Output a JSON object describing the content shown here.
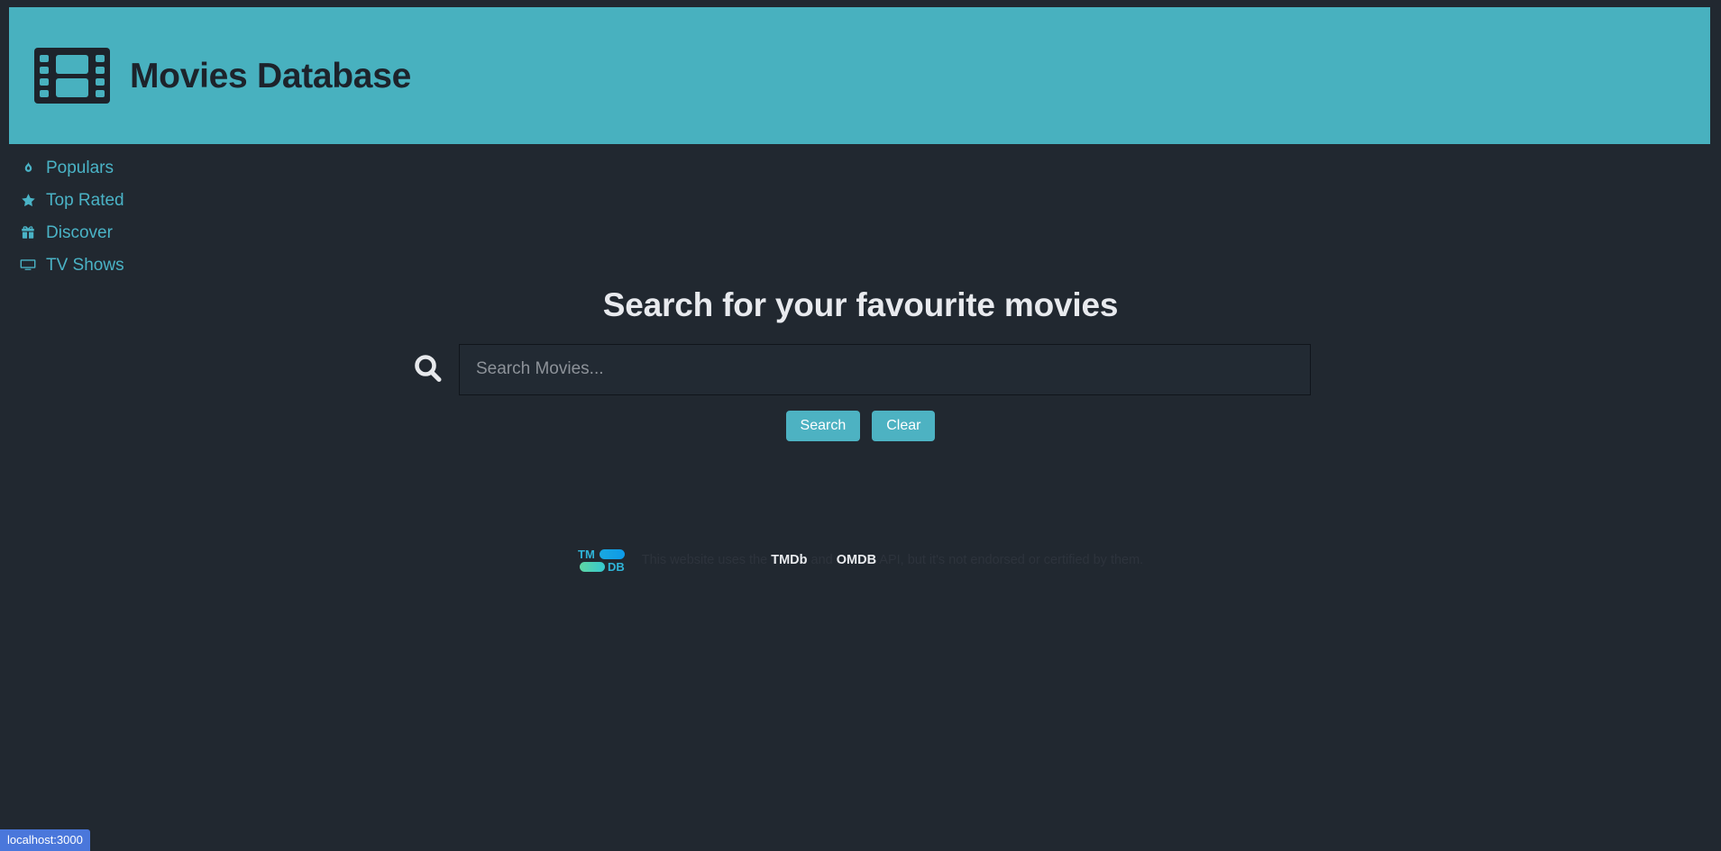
{
  "header": {
    "title": "Movies Database",
    "logo_icon": "film-strip-icon",
    "background_color": "#48b1bf",
    "title_color": "#1d232b"
  },
  "nav": {
    "items": [
      {
        "label": "Populars",
        "icon": "fire-icon"
      },
      {
        "label": "Top Rated",
        "icon": "star-icon"
      },
      {
        "label": "Discover",
        "icon": "gift-icon"
      },
      {
        "label": "TV Shows",
        "icon": "tv-icon"
      }
    ],
    "link_color": "#4ab3c6"
  },
  "search": {
    "heading": "Search for your favourite movies",
    "icon": "search-icon",
    "input_value": "",
    "placeholder": "Search Movies...",
    "search_button": "Search",
    "clear_button": "Clear",
    "button_color": "#4db2c2"
  },
  "footer": {
    "logo_text_top": "TM",
    "logo_text_bottom": "DB",
    "text_before": "This website uses the ",
    "tmdb": "TMDb",
    "text_middle": " and ",
    "omdb": "OMDB",
    "text_after": " API, but it's not endorsed or certified by them."
  },
  "status_bar": {
    "url": "localhost:3000",
    "background_color": "#4a77db"
  }
}
